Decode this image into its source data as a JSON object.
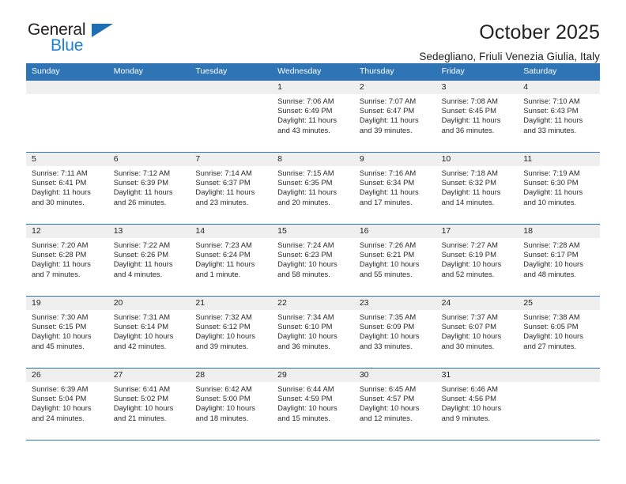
{
  "brand": {
    "name_part1": "General",
    "name_part2": "Blue",
    "triangle_color": "#1f6eb5",
    "blue_color": "#1f7fd4"
  },
  "header": {
    "title": "October 2025",
    "subtitle": "Sedegliano, Friuli Venezia Giulia, Italy"
  },
  "theme": {
    "header_bar_color": "#2f75b5",
    "daynum_bg": "#efefef",
    "rule_color": "#2f75b5"
  },
  "weekdays": [
    "Sunday",
    "Monday",
    "Tuesday",
    "Wednesday",
    "Thursday",
    "Friday",
    "Saturday"
  ],
  "labels": {
    "sunrise_prefix": "Sunrise:",
    "sunset_prefix": "Sunset:",
    "daylight_prefix": "Daylight:"
  },
  "weeks": [
    [
      {
        "day": "",
        "empty": true
      },
      {
        "day": "",
        "empty": true
      },
      {
        "day": "",
        "empty": true
      },
      {
        "day": "1",
        "sunrise": "Sunrise: 7:06 AM",
        "sunset": "Sunset: 6:49 PM",
        "daylight": "Daylight: 11 hours and 43 minutes."
      },
      {
        "day": "2",
        "sunrise": "Sunrise: 7:07 AM",
        "sunset": "Sunset: 6:47 PM",
        "daylight": "Daylight: 11 hours and 39 minutes."
      },
      {
        "day": "3",
        "sunrise": "Sunrise: 7:08 AM",
        "sunset": "Sunset: 6:45 PM",
        "daylight": "Daylight: 11 hours and 36 minutes."
      },
      {
        "day": "4",
        "sunrise": "Sunrise: 7:10 AM",
        "sunset": "Sunset: 6:43 PM",
        "daylight": "Daylight: 11 hours and 33 minutes."
      }
    ],
    [
      {
        "day": "5",
        "sunrise": "Sunrise: 7:11 AM",
        "sunset": "Sunset: 6:41 PM",
        "daylight": "Daylight: 11 hours and 30 minutes."
      },
      {
        "day": "6",
        "sunrise": "Sunrise: 7:12 AM",
        "sunset": "Sunset: 6:39 PM",
        "daylight": "Daylight: 11 hours and 26 minutes."
      },
      {
        "day": "7",
        "sunrise": "Sunrise: 7:14 AM",
        "sunset": "Sunset: 6:37 PM",
        "daylight": "Daylight: 11 hours and 23 minutes."
      },
      {
        "day": "8",
        "sunrise": "Sunrise: 7:15 AM",
        "sunset": "Sunset: 6:35 PM",
        "daylight": "Daylight: 11 hours and 20 minutes."
      },
      {
        "day": "9",
        "sunrise": "Sunrise: 7:16 AM",
        "sunset": "Sunset: 6:34 PM",
        "daylight": "Daylight: 11 hours and 17 minutes."
      },
      {
        "day": "10",
        "sunrise": "Sunrise: 7:18 AM",
        "sunset": "Sunset: 6:32 PM",
        "daylight": "Daylight: 11 hours and 14 minutes."
      },
      {
        "day": "11",
        "sunrise": "Sunrise: 7:19 AM",
        "sunset": "Sunset: 6:30 PM",
        "daylight": "Daylight: 11 hours and 10 minutes."
      }
    ],
    [
      {
        "day": "12",
        "sunrise": "Sunrise: 7:20 AM",
        "sunset": "Sunset: 6:28 PM",
        "daylight": "Daylight: 11 hours and 7 minutes."
      },
      {
        "day": "13",
        "sunrise": "Sunrise: 7:22 AM",
        "sunset": "Sunset: 6:26 PM",
        "daylight": "Daylight: 11 hours and 4 minutes."
      },
      {
        "day": "14",
        "sunrise": "Sunrise: 7:23 AM",
        "sunset": "Sunset: 6:24 PM",
        "daylight": "Daylight: 11 hours and 1 minute."
      },
      {
        "day": "15",
        "sunrise": "Sunrise: 7:24 AM",
        "sunset": "Sunset: 6:23 PM",
        "daylight": "Daylight: 10 hours and 58 minutes."
      },
      {
        "day": "16",
        "sunrise": "Sunrise: 7:26 AM",
        "sunset": "Sunset: 6:21 PM",
        "daylight": "Daylight: 10 hours and 55 minutes."
      },
      {
        "day": "17",
        "sunrise": "Sunrise: 7:27 AM",
        "sunset": "Sunset: 6:19 PM",
        "daylight": "Daylight: 10 hours and 52 minutes."
      },
      {
        "day": "18",
        "sunrise": "Sunrise: 7:28 AM",
        "sunset": "Sunset: 6:17 PM",
        "daylight": "Daylight: 10 hours and 48 minutes."
      }
    ],
    [
      {
        "day": "19",
        "sunrise": "Sunrise: 7:30 AM",
        "sunset": "Sunset: 6:15 PM",
        "daylight": "Daylight: 10 hours and 45 minutes."
      },
      {
        "day": "20",
        "sunrise": "Sunrise: 7:31 AM",
        "sunset": "Sunset: 6:14 PM",
        "daylight": "Daylight: 10 hours and 42 minutes."
      },
      {
        "day": "21",
        "sunrise": "Sunrise: 7:32 AM",
        "sunset": "Sunset: 6:12 PM",
        "daylight": "Daylight: 10 hours and 39 minutes."
      },
      {
        "day": "22",
        "sunrise": "Sunrise: 7:34 AM",
        "sunset": "Sunset: 6:10 PM",
        "daylight": "Daylight: 10 hours and 36 minutes."
      },
      {
        "day": "23",
        "sunrise": "Sunrise: 7:35 AM",
        "sunset": "Sunset: 6:09 PM",
        "daylight": "Daylight: 10 hours and 33 minutes."
      },
      {
        "day": "24",
        "sunrise": "Sunrise: 7:37 AM",
        "sunset": "Sunset: 6:07 PM",
        "daylight": "Daylight: 10 hours and 30 minutes."
      },
      {
        "day": "25",
        "sunrise": "Sunrise: 7:38 AM",
        "sunset": "Sunset: 6:05 PM",
        "daylight": "Daylight: 10 hours and 27 minutes."
      }
    ],
    [
      {
        "day": "26",
        "sunrise": "Sunrise: 6:39 AM",
        "sunset": "Sunset: 5:04 PM",
        "daylight": "Daylight: 10 hours and 24 minutes."
      },
      {
        "day": "27",
        "sunrise": "Sunrise: 6:41 AM",
        "sunset": "Sunset: 5:02 PM",
        "daylight": "Daylight: 10 hours and 21 minutes."
      },
      {
        "day": "28",
        "sunrise": "Sunrise: 6:42 AM",
        "sunset": "Sunset: 5:00 PM",
        "daylight": "Daylight: 10 hours and 18 minutes."
      },
      {
        "day": "29",
        "sunrise": "Sunrise: 6:44 AM",
        "sunset": "Sunset: 4:59 PM",
        "daylight": "Daylight: 10 hours and 15 minutes."
      },
      {
        "day": "30",
        "sunrise": "Sunrise: 6:45 AM",
        "sunset": "Sunset: 4:57 PM",
        "daylight": "Daylight: 10 hours and 12 minutes."
      },
      {
        "day": "31",
        "sunrise": "Sunrise: 6:46 AM",
        "sunset": "Sunset: 4:56 PM",
        "daylight": "Daylight: 10 hours and 9 minutes."
      },
      {
        "day": "",
        "empty": true
      }
    ]
  ]
}
